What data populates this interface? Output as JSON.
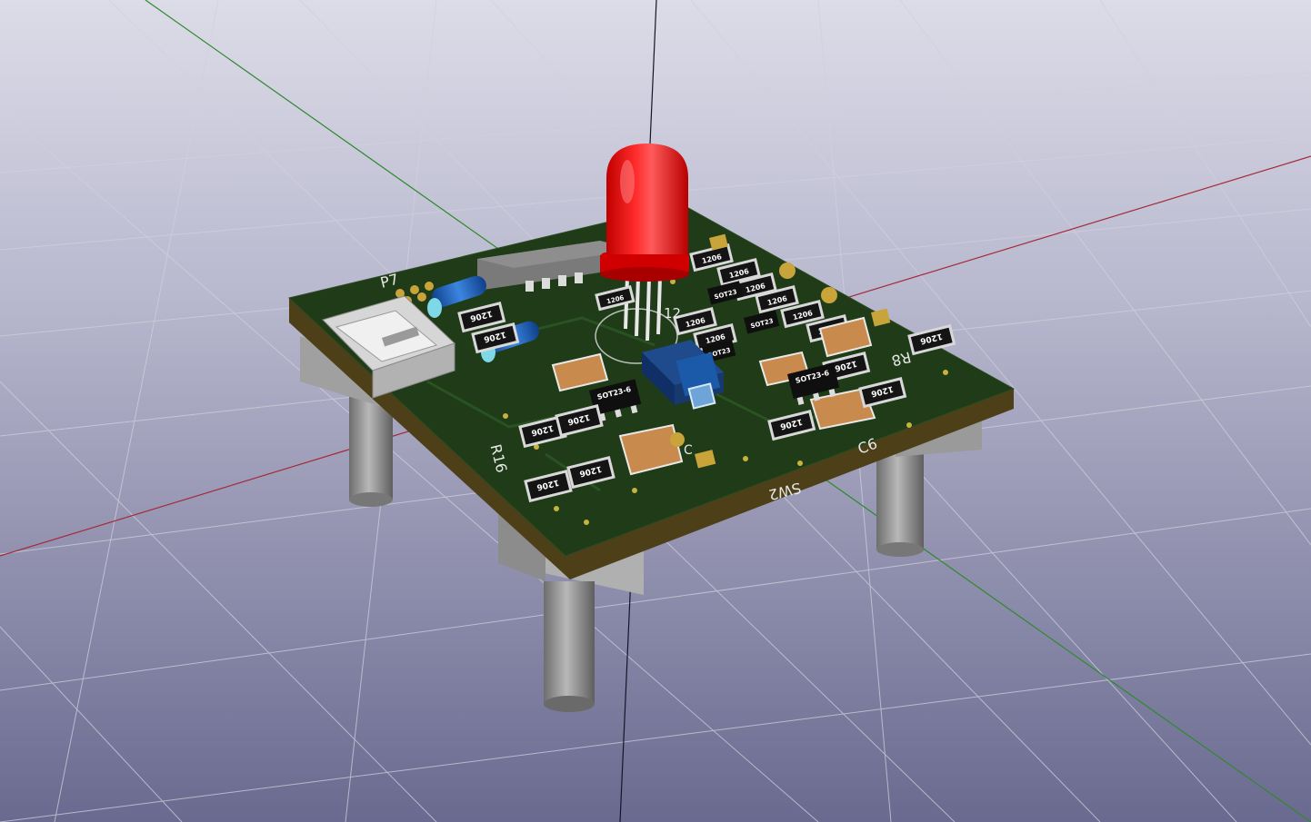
{
  "scene": {
    "background_top": "#d6d6e3",
    "background_bottom": "#6d6d92",
    "grid_color": "#c7c7d7",
    "axis_x_color": "#a02030",
    "axis_y_color": "#2a8a2a",
    "axis_z_color": "#1a1a2a",
    "board_color": "#1e3a17",
    "board_edge_color": "#5a4a1e"
  },
  "silkscreen": {
    "p7": "P7",
    "r16": "R16",
    "r8": "R8",
    "c6": "C6",
    "sw2": "SW2",
    "d12": "12",
    "c_lbl": "C"
  },
  "packages": {
    "r1206": "1206",
    "sot23_6": "SOT23-6",
    "sot23": "SOT23"
  },
  "components": {
    "led_color": "#ff1a1a",
    "resistor_color": "#151515",
    "capacitor_color": "#c98a4e",
    "diode_color": "#1f62b8",
    "switch_color": "#153a78",
    "usb_color": "#c9c9c9",
    "standoff_color": "#8e8e8e"
  }
}
